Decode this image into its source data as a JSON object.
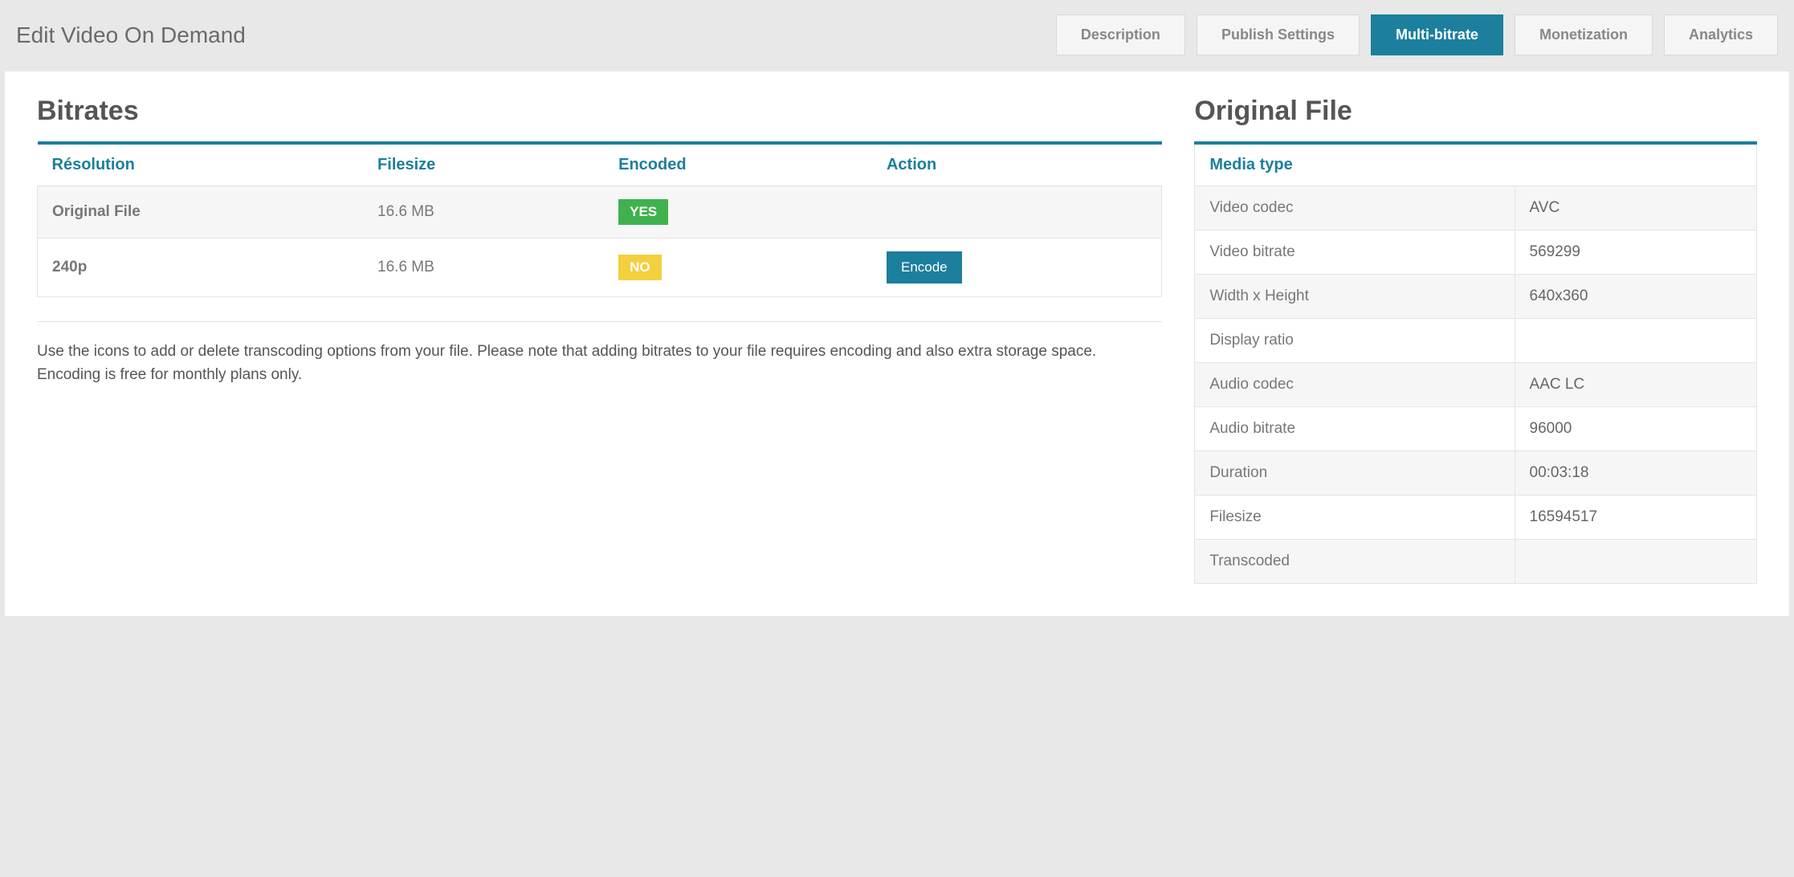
{
  "header": {
    "title": "Edit Video On Demand",
    "tabs": [
      {
        "label": "Description",
        "active": false
      },
      {
        "label": "Publish Settings",
        "active": false
      },
      {
        "label": "Multi-bitrate",
        "active": true
      },
      {
        "label": "Monetization",
        "active": false
      },
      {
        "label": "Analytics",
        "active": false
      }
    ]
  },
  "bitrates": {
    "title": "Bitrates",
    "columns": {
      "resolution": "Résolution",
      "filesize": "Filesize",
      "encoded": "Encoded",
      "action": "Action"
    },
    "rows": [
      {
        "resolution": "Original File",
        "filesize": "16.6 MB",
        "encoded": "YES",
        "action": ""
      },
      {
        "resolution": "240p",
        "filesize": "16.6 MB",
        "encoded": "NO",
        "action": "Encode"
      }
    ],
    "helptext": "Use the icons to add or delete transcoding options from your file. Please note that adding bitrates to your file requires encoding and also extra storage space. Encoding is free for monthly plans only."
  },
  "original": {
    "title": "Original File",
    "header": "Media type",
    "rows": [
      {
        "label": "Video codec",
        "value": "AVC"
      },
      {
        "label": "Video bitrate",
        "value": "569299"
      },
      {
        "label": "Width x Height",
        "value": "640x360"
      },
      {
        "label": "Display ratio",
        "value": ""
      },
      {
        "label": "Audio codec",
        "value": "AAC LC"
      },
      {
        "label": "Audio bitrate",
        "value": "96000"
      },
      {
        "label": "Duration",
        "value": "00:03:18"
      },
      {
        "label": "Filesize",
        "value": "16594517"
      },
      {
        "label": "Transcoded",
        "value": ""
      }
    ]
  }
}
